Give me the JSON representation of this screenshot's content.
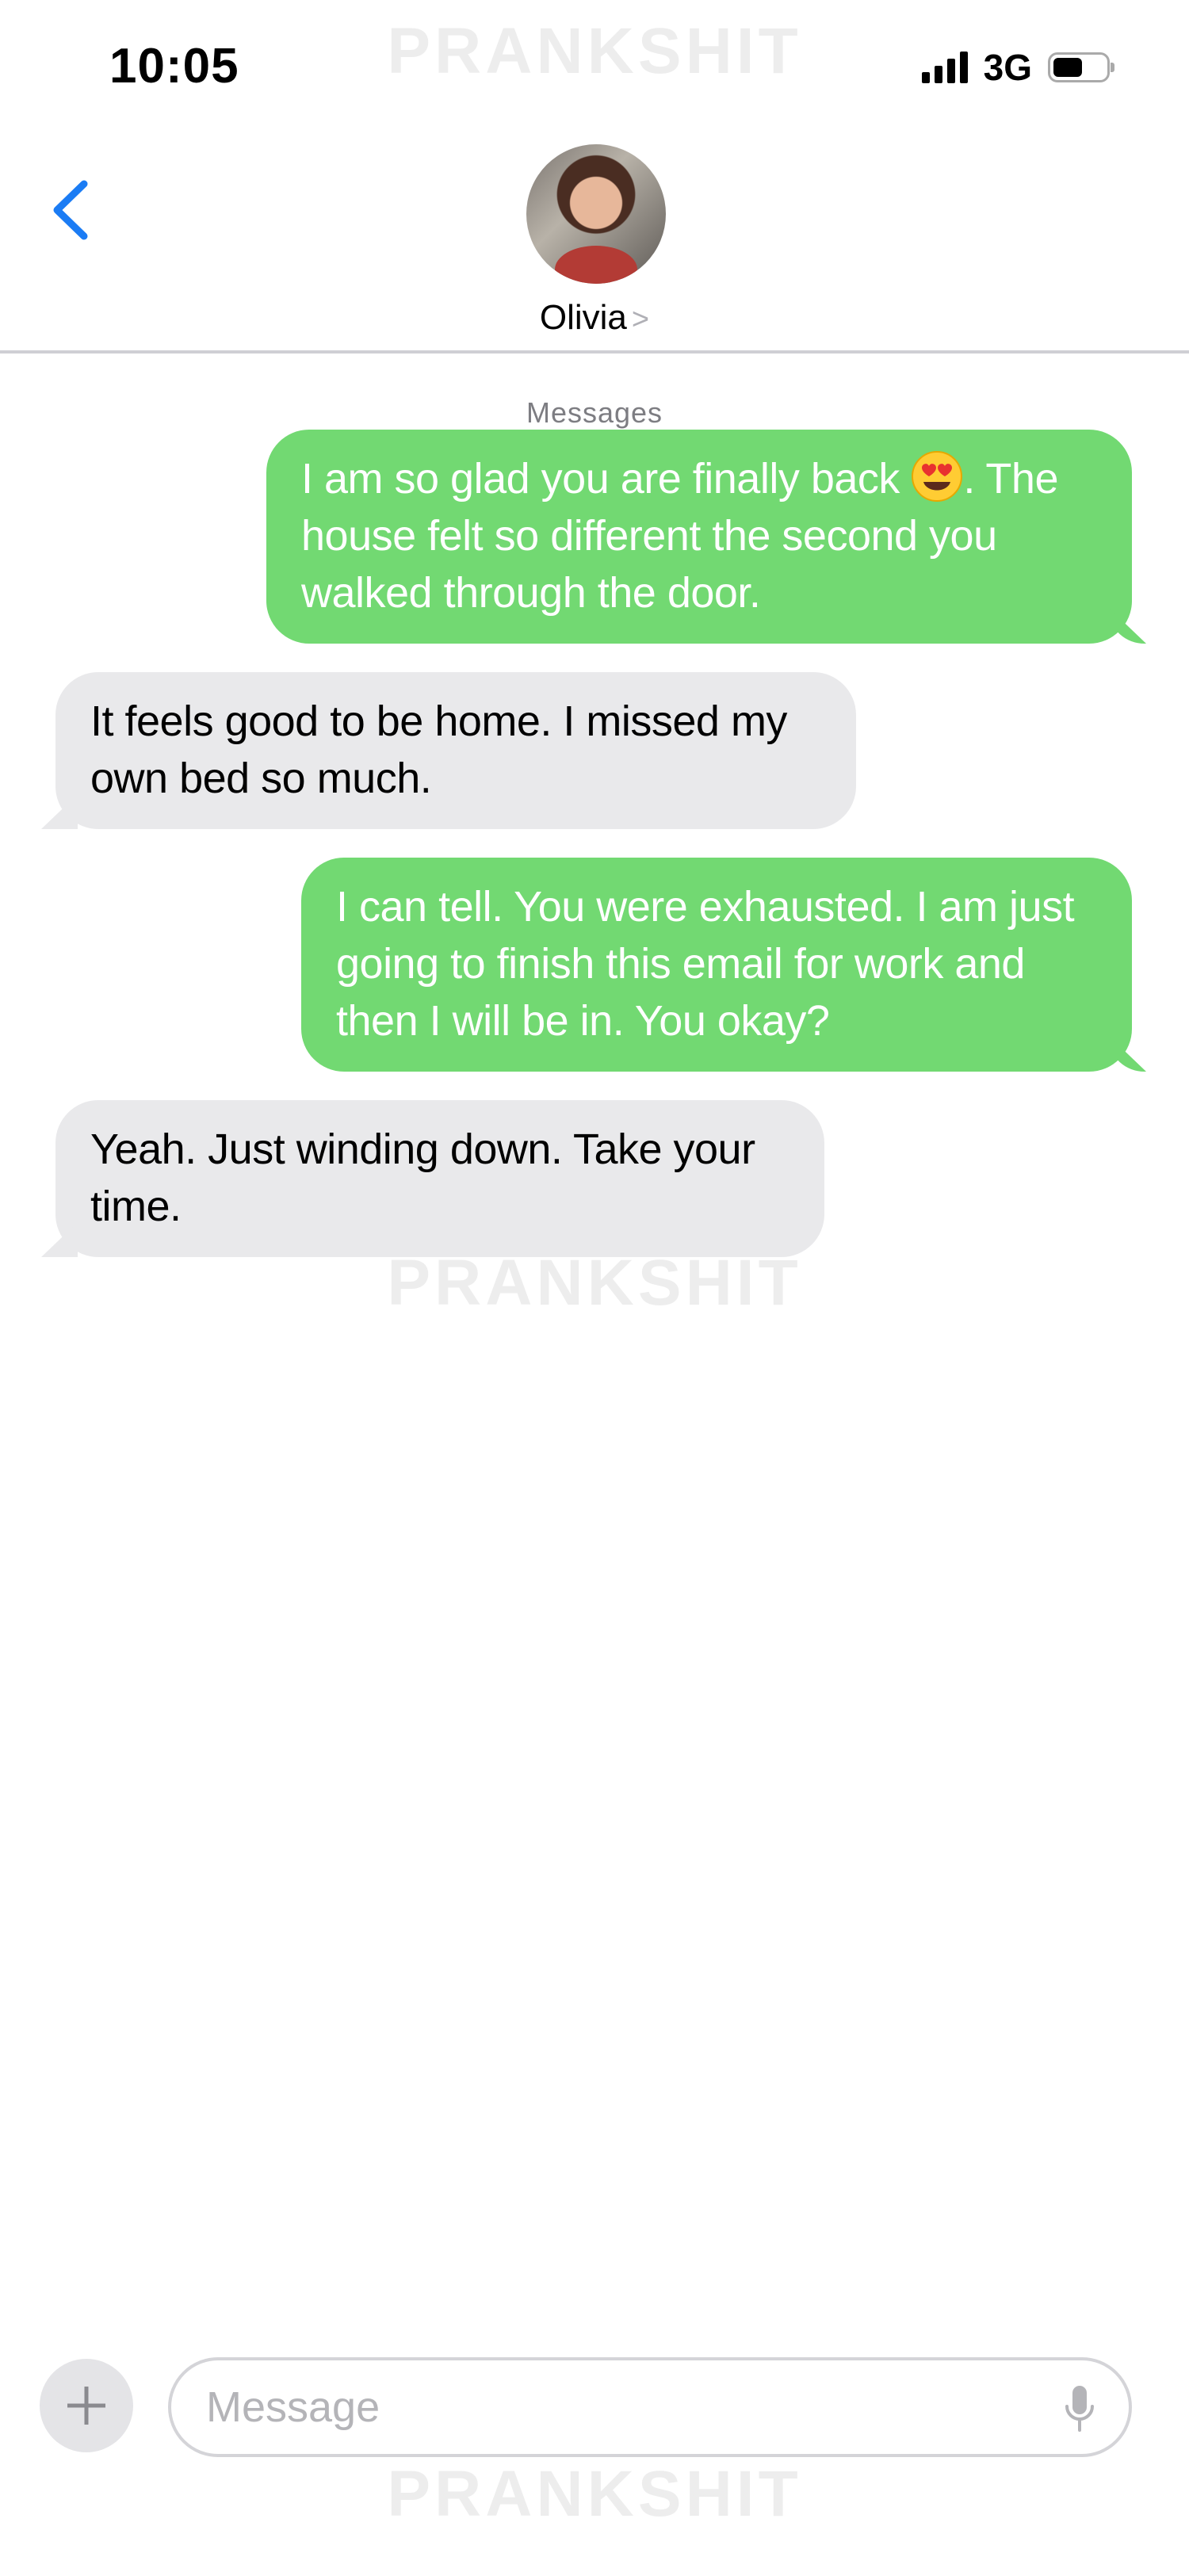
{
  "status_bar": {
    "time": "10:05",
    "network": "3G",
    "signal_bars": 4,
    "battery_level": 0.55
  },
  "watermark": "PRANKSHIT",
  "header": {
    "contact_name": "Olivia",
    "contact_chevron": ">",
    "back_icon": "chevron-left-icon",
    "accent_color": "#1b7cf4"
  },
  "thread": {
    "service_label": "Messages",
    "messages": [
      {
        "direction": "sent",
        "text_before_emoji": "I am so glad you are finally back ",
        "emoji": "heart-eyes-emoji",
        "text_after_emoji": ". The house felt so different the second you walked through the door."
      },
      {
        "direction": "received",
        "text": "It feels good to be home. I missed my own bed so much."
      },
      {
        "direction": "sent",
        "text": "I can tell. You were exhausted. I am just going to finish this email for work and then I will be in. You okay?"
      },
      {
        "direction": "received",
        "text": "Yeah. Just winding down. Take your time."
      }
    ],
    "sent_bubble_color": "#72d972",
    "received_bubble_color": "#e9e9eb"
  },
  "composer": {
    "placeholder": "Message",
    "plus_icon": "plus-icon",
    "mic_icon": "microphone-icon"
  }
}
